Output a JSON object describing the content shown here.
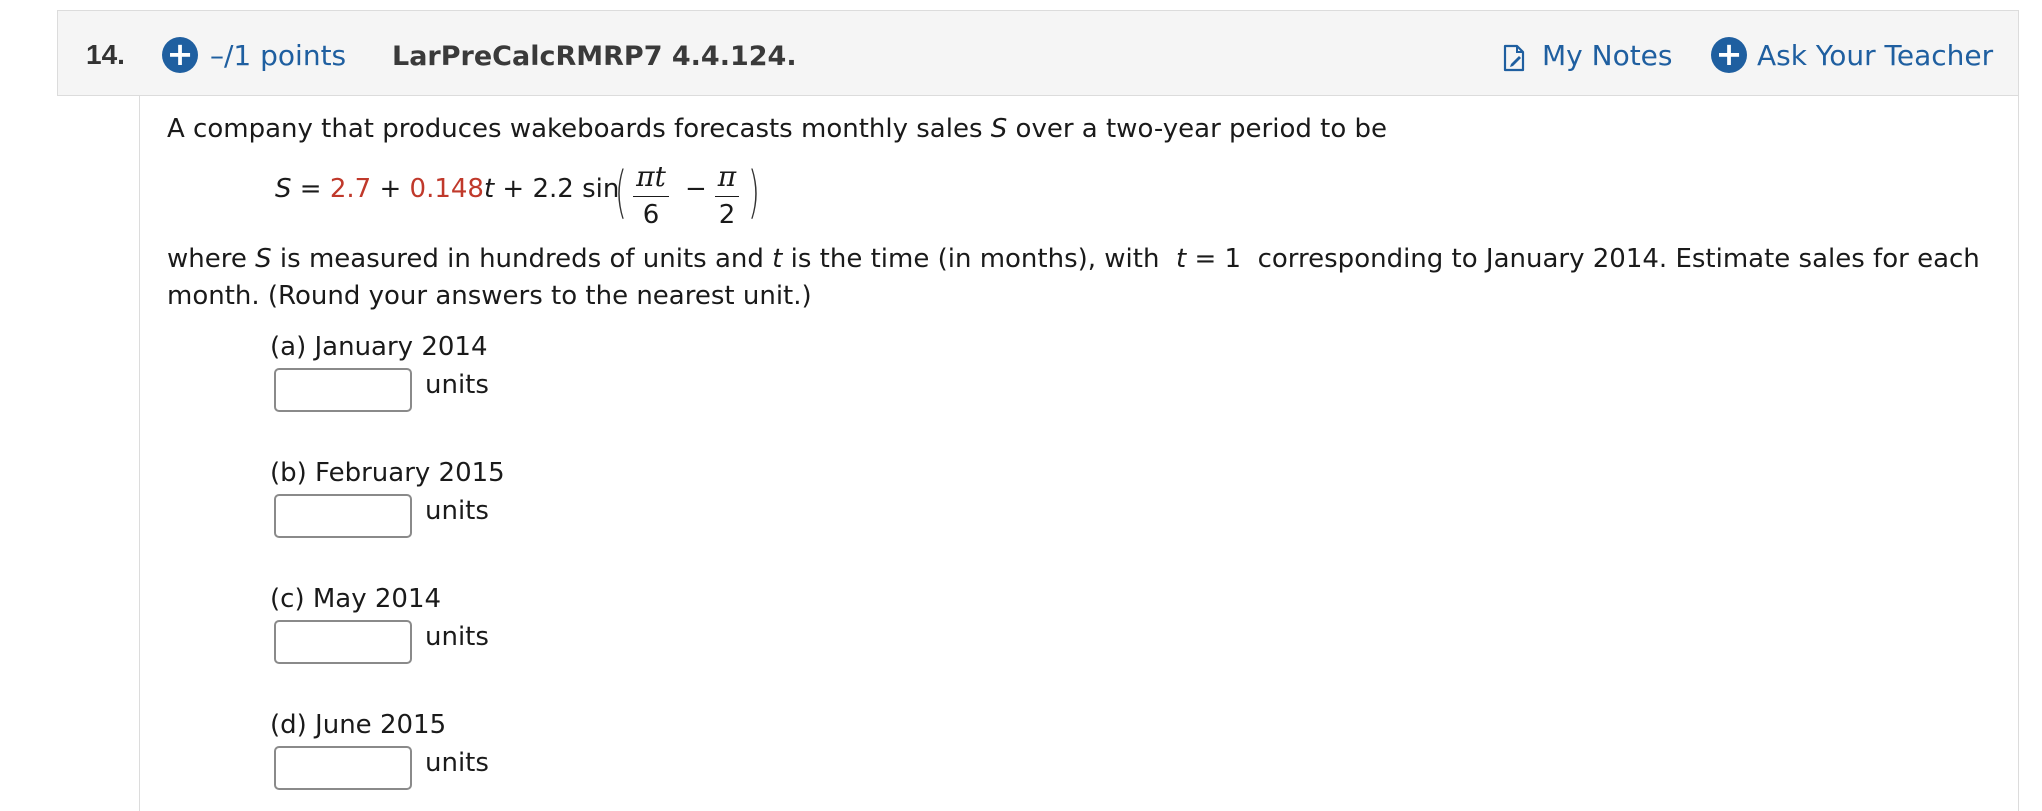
{
  "question": {
    "number": "14.",
    "points_label": "–/1 points",
    "reference": "LarPreCalcRMRP7 4.4.124.",
    "my_notes_label": "My Notes",
    "ask_teacher_label": "Ask Your Teacher",
    "icons": {
      "points": "plus-circle-icon",
      "notes": "notes-icon",
      "ask": "plus-circle-icon"
    },
    "accent_color": "#1f5fa0"
  },
  "problem": {
    "intro_pre": "A company that produces wakeboards forecasts monthly sales ",
    "intro_var": "S",
    "intro_post": " over a two-year period to be",
    "formula": {
      "lhs": "S",
      "eq": " = ",
      "a": "2.7",
      "plus1": " + ",
      "b": "0.148",
      "t": "t",
      "rest": " + 2.2 sin",
      "frac1_num": "πt",
      "frac1_den": "6",
      "minus": "−",
      "frac2_num": "π",
      "frac2_den": "2",
      "highlight_color": "#c0392b"
    },
    "where_pre": "where ",
    "where_s": "S",
    "where_mid": " is measured in hundreds of units and ",
    "where_t": "t",
    "where_mid2": " is the time (in months), with  ",
    "where_t2": "t",
    "where_eq": " = 1",
    "where_post": "  corresponding to January 2014. Estimate sales for each",
    "month_line": "month. (Round your answers to the nearest unit.)"
  },
  "parts": [
    {
      "label": "(a) January 2014",
      "value": "",
      "units": "units"
    },
    {
      "label": "(b) February 2015",
      "value": "",
      "units": "units"
    },
    {
      "label": "(c) May 2014",
      "value": "",
      "units": "units"
    },
    {
      "label": "(d) June 2015",
      "value": "",
      "units": "units"
    }
  ]
}
